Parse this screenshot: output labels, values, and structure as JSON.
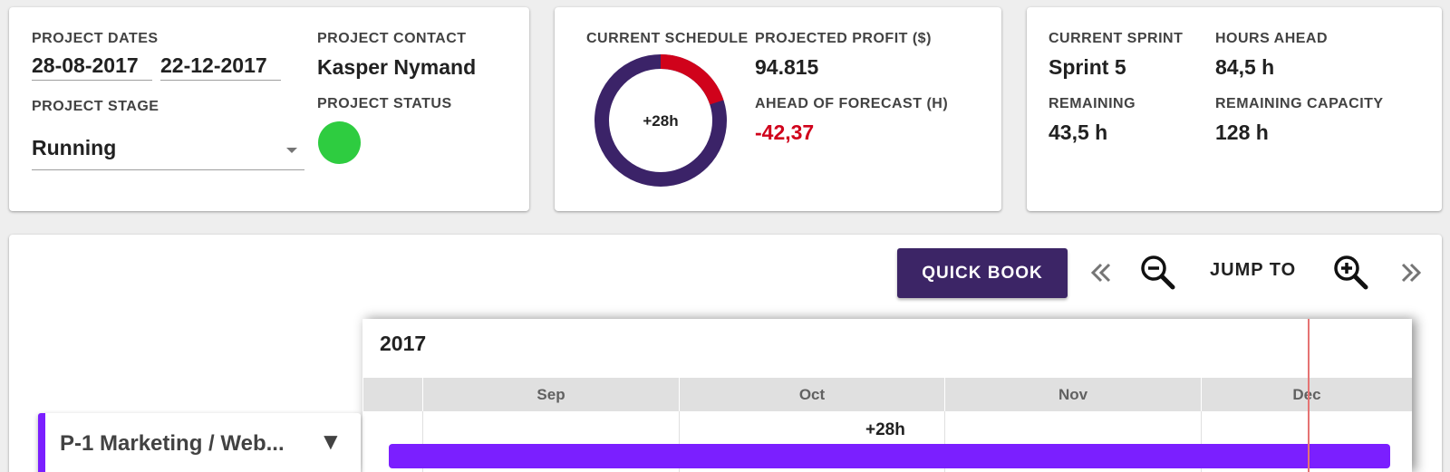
{
  "project_info": {
    "dates_label": "PROJECT DATES",
    "start_date": "28-08-2017",
    "end_date": "22-12-2017",
    "contact_label": "PROJECT CONTACT",
    "contact_value": "Kasper Nymand",
    "stage_label": "PROJECT STAGE",
    "stage_value": "Running",
    "status_label": "PROJECT STATUS",
    "status_color": "#2ecc40"
  },
  "schedule": {
    "schedule_label": "CURRENT SCHEDULE",
    "donut_center": "+28h",
    "donut_fraction_red": 0.2,
    "donut_colors": {
      "main": "#3b2368",
      "over": "#d0021b"
    },
    "profit_label": "PROJECTED PROFIT ($)",
    "profit_value": "94.815",
    "forecast_label": "AHEAD OF FORECAST (H)",
    "forecast_value": "-42,37",
    "forecast_color": "#d0021b"
  },
  "sprint": {
    "current_label": "CURRENT SPRINT",
    "current_value": "Sprint 5",
    "hours_ahead_label": "HOURS AHEAD",
    "hours_ahead_value": "84,5 h",
    "remaining_label": "REMAINING",
    "remaining_value": "43,5 h",
    "capacity_label": "REMAINING CAPACITY",
    "capacity_value": "128 h"
  },
  "toolbar": {
    "quick_book_label": "QUICK BOOK",
    "jump_to_label": "JUMP TO",
    "prev_icon": "double-chevron-left-icon",
    "zoom_out_icon": "zoom-out-icon",
    "zoom_in_icon": "zoom-in-icon",
    "next_icon": "double-chevron-right-icon"
  },
  "timeline": {
    "year": "2017",
    "months": [
      "Sep",
      "Oct",
      "Nov",
      "Dec"
    ],
    "bar_label": "+28h",
    "bar_color": "#7b1fff",
    "project_name": "P-1 Marketing / Web...",
    "project_toggle": "▼"
  }
}
